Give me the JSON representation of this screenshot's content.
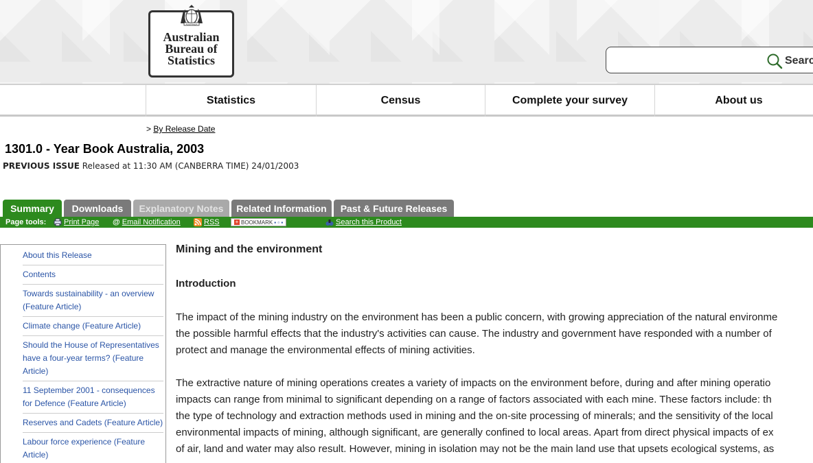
{
  "logo": {
    "line1": "Australian",
    "line2": "Bureau of",
    "line3": "Statistics",
    "crest_text": "AUSTRALIA"
  },
  "search": {
    "placeholder": "",
    "button_label": "Search"
  },
  "mainnav": [
    "Statistics",
    "Census",
    "Complete your survey",
    "About us"
  ],
  "breadcrumb": {
    "prefix": ">",
    "link": "By Release Date"
  },
  "release": {
    "title": "1301.0 - Year Book Australia, 2003",
    "issue_label": "PREVIOUS ISSUE",
    "released_text": "Released at 11:30 AM (CANBERRA TIME) 24/01/2003"
  },
  "tabs": [
    {
      "label": "Summary",
      "state": "active",
      "color": "#2d8a1e"
    },
    {
      "label": "Downloads",
      "state": "normal",
      "color": "#7a7a7a"
    },
    {
      "label": "Explanatory Notes",
      "state": "disabled",
      "color": "#a9a9a9"
    },
    {
      "label": "Related Information",
      "state": "normal",
      "color": "#7a7a7a"
    },
    {
      "label": "Past & Future Releases",
      "state": "normal",
      "color": "#7a7a7a"
    }
  ],
  "toolbar": {
    "label": "Page tools:",
    "print": "Print Page",
    "email": "Email Notification",
    "rss": "RSS",
    "bookmark": "BOOKMARK",
    "search_product": "Search this Product"
  },
  "sidebar": [
    [
      "About this Release"
    ],
    [
      "Contents"
    ],
    [
      "Towards sustainability - an overview",
      "(Feature Article)"
    ],
    [
      "Climate change (Feature Article)"
    ],
    [
      "Should the House of Representatives",
      "have a four-year terms? (Feature",
      "Article)"
    ],
    [
      "11 September 2001 - consequences",
      "for Defence (Feature Article)"
    ],
    [
      "Reserves and Cadets (Feature Article)"
    ],
    [
      "Labour force experience (Feature",
      "Article)"
    ]
  ],
  "content": {
    "heading": "Mining and the environment",
    "subheading": "Introduction",
    "para1": [
      "The impact of the mining industry on the environment has been a public concern, with growing appreciation of the natural environme",
      "the possible harmful effects that the industry's activities can cause. The industry and government have responded with a number of",
      "protect and manage the environmental effects of mining activities."
    ],
    "para2": [
      "The extractive nature of mining operations creates a variety of impacts on the environment before, during and after mining operatio",
      "impacts can range from minimal to significant depending on a range of factors associated with each mine. These factors include: th",
      "the type of technology and extraction methods used in mining and the on-site processing of minerals; and the sensitivity of the local",
      "environmental impacts of mining, although significant, are generally confined to local areas. Apart from direct physical impacts of ex",
      "of air, land and water may also result. However, mining in isolation may not be the main land use that upsets ecological systems, as"
    ]
  },
  "colors": {
    "accent_green": "#2d8a1e",
    "link_blue": "#2a54a6",
    "tab_grey": "#7a7a7a"
  }
}
